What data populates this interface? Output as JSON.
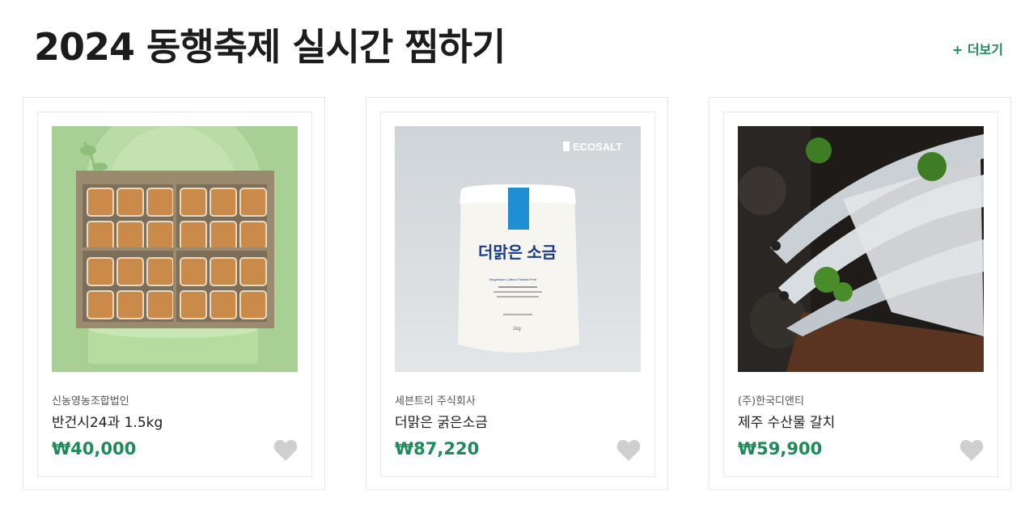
{
  "header": {
    "title": "2024 동행축제 실시간 찜하기",
    "more_label": "+ 더보기"
  },
  "colors": {
    "accent": "#1e8a5a",
    "heart": "#cfcfcf"
  },
  "products": [
    {
      "seller": "신농영농조합법인",
      "name": "반건시24과 1.5kg",
      "price": "₩40,000",
      "image": "dried-persimmon-gift-box"
    },
    {
      "seller": "세븐트리 주식회사",
      "name": "더맑은 굵은소금",
      "price": "₩87,220",
      "image": "ecosalt-salt-pouch",
      "image_texts": {
        "brand": "ECOSALT",
        "logo": "더맑은 소금",
        "line": "Magnesium | Micro-Plastics Free",
        "weight": "1kg"
      }
    },
    {
      "seller": "(주)한국디앤티",
      "name": "제주 수산물 갈치",
      "price": "₩59,900",
      "image": "hairtail-fish-platter"
    }
  ]
}
